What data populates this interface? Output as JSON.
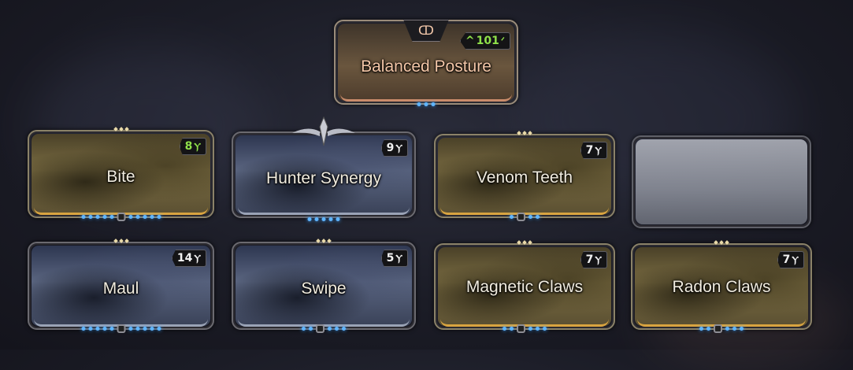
{
  "stance": {
    "name": "Balanced Posture",
    "drain": "101",
    "drain_prefix": "^",
    "polarity_icon": "madurai-polarity-icon",
    "emblem_icon": "stance-emblem-icon"
  },
  "mods": [
    {
      "name": "Bite",
      "drain": "8",
      "style": "gold",
      "drain_color": "green",
      "pips": 10
    },
    {
      "name": "Hunter Synergy",
      "drain": "9",
      "style": "blue",
      "pips": 5
    },
    {
      "name": "Venom Teeth",
      "drain": "7",
      "style": "gold",
      "pips": 3
    },
    {
      "name": "",
      "drain": "",
      "style": "empty",
      "pips": 0
    },
    {
      "name": "Maul",
      "drain": "14",
      "style": "blue",
      "pips": 10
    },
    {
      "name": "Swipe",
      "drain": "5",
      "style": "blue",
      "pips": 5
    },
    {
      "name": "Magnetic Claws",
      "drain": "7",
      "style": "gold",
      "pips": 5
    },
    {
      "name": "Radon Claws",
      "drain": "7",
      "style": "gold",
      "pips": 5
    }
  ],
  "colors": {
    "pip": "#5fb5ff",
    "gold_trim": "#d9a440",
    "green_drain": "#8fe04a"
  }
}
